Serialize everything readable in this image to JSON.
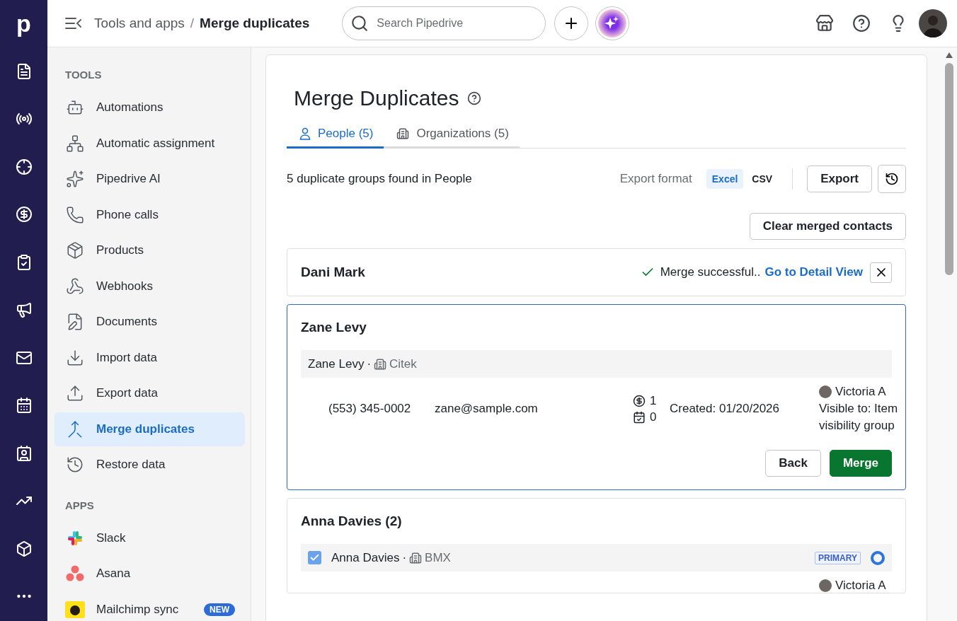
{
  "brand_logo": "p",
  "topbar": {
    "breadcrumb": [
      "Tools and apps",
      "Merge duplicates"
    ],
    "breadcrumb_separator": "/",
    "search": {
      "placeholder": "Search Pipedrive"
    }
  },
  "sidebar": {
    "sections": [
      {
        "heading": "TOOLS",
        "items": [
          {
            "label": "Automations",
            "selected": false
          },
          {
            "label": "Automatic assignment",
            "selected": false
          },
          {
            "label": "Pipedrive AI",
            "selected": false
          },
          {
            "label": "Phone calls",
            "selected": false
          },
          {
            "label": "Products",
            "selected": false
          },
          {
            "label": "Webhooks",
            "selected": false
          },
          {
            "label": "Documents",
            "selected": false
          },
          {
            "label": "Import data",
            "selected": false
          },
          {
            "label": "Export data",
            "selected": false
          },
          {
            "label": "Merge duplicates",
            "selected": true
          },
          {
            "label": "Restore data",
            "selected": false
          }
        ]
      },
      {
        "heading": "APPS",
        "items": [
          {
            "label": "Slack",
            "selected": false
          },
          {
            "label": "Asana",
            "selected": false
          },
          {
            "label": "Mailchimp sync",
            "selected": false,
            "badge": "NEW"
          }
        ]
      }
    ]
  },
  "main": {
    "title": "Merge Duplicates",
    "tabs": [
      {
        "label": "People (5)",
        "selected": true
      },
      {
        "label": "Organizations (5)",
        "selected": false
      }
    ],
    "summary": "5 duplicate groups found in People",
    "export": {
      "label": "Export format",
      "formats": [
        {
          "label": "Excel",
          "selected": true
        },
        {
          "label": "CSV",
          "selected": false
        }
      ],
      "button": "Export"
    },
    "clear_button": "Clear merged contacts",
    "groups": [
      {
        "kind": "merged",
        "name": "Dani Mark",
        "selected": false,
        "message": "Merge successful..",
        "link": "Go to Detail View"
      },
      {
        "kind": "review",
        "name": "Zane Levy",
        "selected": true,
        "records": [
          {
            "name": "Zane Levy",
            "separator": "·",
            "org": "Citek",
            "phone": "(553) 345-0002",
            "email": "zane@sample.com",
            "deals": "1",
            "activities": "0",
            "created": "Created: 01/20/2026",
            "owner": "Victoria A",
            "visibility": [
              "Visible to: Item",
              "visibility group"
            ]
          }
        ],
        "buttons": [
          "Back",
          "Merge"
        ]
      },
      {
        "kind": "review",
        "name": "Anna Davies (2)",
        "selected": false,
        "records": [
          {
            "name": "Anna Davies",
            "separator": "·",
            "org": "BMX",
            "checked": true,
            "badge": "PRIMARY",
            "primary": true,
            "owner": "Victoria A"
          }
        ]
      }
    ]
  }
}
